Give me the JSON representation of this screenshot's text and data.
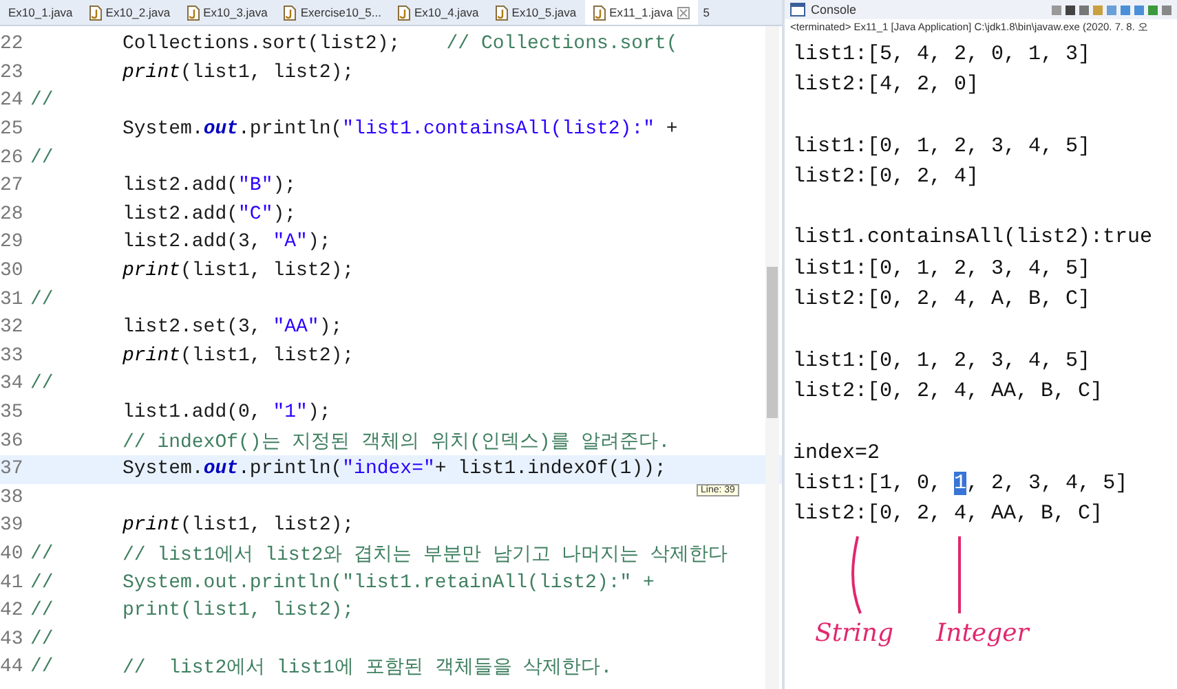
{
  "editor": {
    "tabs": [
      {
        "label": "Ex10_1.java",
        "selected": false,
        "icon": false
      },
      {
        "label": "Ex10_2.java",
        "selected": false,
        "icon": true
      },
      {
        "label": "Ex10_3.java",
        "selected": false,
        "icon": true
      },
      {
        "label": "Exercise10_5...",
        "selected": false,
        "icon": true
      },
      {
        "label": "Ex10_4.java",
        "selected": false,
        "icon": true
      },
      {
        "label": "Ex10_5.java",
        "selected": false,
        "icon": true
      },
      {
        "label": "Ex11_1.java",
        "selected": true,
        "icon": true
      }
    ],
    "overflow": "5",
    "lines": [
      {
        "number": "22",
        "current": false,
        "tokens": [
          {
            "kind": "plain",
            "text": "Collections.sort(list2);    "
          },
          {
            "kind": "comment",
            "text": "// Collections.sort("
          }
        ]
      },
      {
        "number": "23",
        "current": false,
        "tokens": [
          {
            "kind": "method",
            "text": "print"
          },
          {
            "kind": "plain",
            "text": "(list1, list2);"
          }
        ]
      },
      {
        "number": "24",
        "current": false,
        "marker": "//"
      },
      {
        "number": "25",
        "current": false,
        "tokens": [
          {
            "kind": "plain",
            "text": "System."
          },
          {
            "kind": "field",
            "text": "out"
          },
          {
            "kind": "plain",
            "text": ".println("
          },
          {
            "kind": "string",
            "text": "\"list1.containsAll(list2):\""
          },
          {
            "kind": "plain",
            "text": " +"
          }
        ]
      },
      {
        "number": "26",
        "current": false,
        "marker": "//"
      },
      {
        "number": "27",
        "current": false,
        "tokens": [
          {
            "kind": "plain",
            "text": "list2.add("
          },
          {
            "kind": "string",
            "text": "\"B\""
          },
          {
            "kind": "plain",
            "text": ");"
          }
        ]
      },
      {
        "number": "28",
        "current": false,
        "tokens": [
          {
            "kind": "plain",
            "text": "list2.add("
          },
          {
            "kind": "string",
            "text": "\"C\""
          },
          {
            "kind": "plain",
            "text": ");"
          }
        ]
      },
      {
        "number": "29",
        "current": false,
        "tokens": [
          {
            "kind": "plain",
            "text": "list2.add(3, "
          },
          {
            "kind": "string",
            "text": "\"A\""
          },
          {
            "kind": "plain",
            "text": ");"
          }
        ]
      },
      {
        "number": "30",
        "current": false,
        "tokens": [
          {
            "kind": "method",
            "text": "print"
          },
          {
            "kind": "plain",
            "text": "(list1, list2);"
          }
        ]
      },
      {
        "number": "31",
        "current": false,
        "marker": "//"
      },
      {
        "number": "32",
        "current": false,
        "tokens": [
          {
            "kind": "plain",
            "text": "list2.set(3, "
          },
          {
            "kind": "string",
            "text": "\"AA\""
          },
          {
            "kind": "plain",
            "text": ");"
          }
        ]
      },
      {
        "number": "33",
        "current": false,
        "tokens": [
          {
            "kind": "method",
            "text": "print"
          },
          {
            "kind": "plain",
            "text": "(list1, list2);"
          }
        ]
      },
      {
        "number": "34",
        "current": false,
        "marker": "//"
      },
      {
        "number": "35",
        "current": false,
        "tokens": [
          {
            "kind": "plain",
            "text": "list1.add(0, "
          },
          {
            "kind": "string",
            "text": "\"1\""
          },
          {
            "kind": "plain",
            "text": ");"
          }
        ]
      },
      {
        "number": "36",
        "current": false,
        "tokens": [
          {
            "kind": "comment",
            "text": "// indexOf()는 지정된 객체의 위치(인덱스)를 알려준다."
          }
        ]
      },
      {
        "number": "37",
        "current": true,
        "tokens": [
          {
            "kind": "plain",
            "text": "System."
          },
          {
            "kind": "field",
            "text": "out"
          },
          {
            "kind": "plain",
            "text": ".println("
          },
          {
            "kind": "string",
            "text": "\"index=\""
          },
          {
            "kind": "plain",
            "text": "+ list1.indexOf(1));"
          }
        ]
      },
      {
        "number": "38",
        "current": false
      },
      {
        "number": "39",
        "current": false,
        "tokens": [
          {
            "kind": "method",
            "text": "print"
          },
          {
            "kind": "plain",
            "text": "(list1, list2);"
          }
        ]
      },
      {
        "number": "40",
        "current": false,
        "marker": "//",
        "tokens": [
          {
            "kind": "comment",
            "text": "// list1에서 list2와 겹치는 부분만 남기고 나머지는 삭제한다"
          }
        ]
      },
      {
        "number": "41",
        "current": false,
        "marker": "//",
        "tokens": [
          {
            "kind": "comment",
            "text": "System.out.println(\"list1.retainAll(list2):\" +"
          }
        ]
      },
      {
        "number": "42",
        "current": false,
        "marker": "//",
        "tokens": [
          {
            "kind": "comment",
            "text": "print(list1, list2);"
          }
        ]
      },
      {
        "number": "43",
        "current": false,
        "marker": "//"
      },
      {
        "number": "44",
        "current": false,
        "marker": "//",
        "tokens": [
          {
            "kind": "comment",
            "text": "//  list2에서 list1에 포함된 객체들을 삭제한다."
          }
        ]
      }
    ],
    "tooltip": "Line: 39"
  },
  "console": {
    "title": "Console",
    "status": "<terminated> Ex11_1 [Java Application] C:\\jdk1.8\\bin\\javaw.exe (2020. 7. 8. 오",
    "output": [
      {
        "space_before": false,
        "segments": [
          {
            "text": "list1:[5, 4, 2, 0, 1, 3]",
            "selected": false
          }
        ]
      },
      {
        "space_before": false,
        "segments": [
          {
            "text": "list2:[4, 2, 0]",
            "selected": false
          }
        ]
      },
      {
        "space_before": true,
        "segments": [
          {
            "text": "list1:[0, 1, 2, 3, 4, 5]",
            "selected": false
          }
        ]
      },
      {
        "space_before": false,
        "segments": [
          {
            "text": "list2:[0, 2, 4]",
            "selected": false
          }
        ]
      },
      {
        "space_before": true,
        "segments": [
          {
            "text": "list1.containsAll(list2):true",
            "selected": false
          }
        ]
      },
      {
        "space_before": false,
        "segments": [
          {
            "text": "list1:[0, 1, 2, 3, 4, 5]",
            "selected": false
          }
        ]
      },
      {
        "space_before": false,
        "segments": [
          {
            "text": "list2:[0, 2, 4, A, B, C]",
            "selected": false
          }
        ]
      },
      {
        "space_before": true,
        "segments": [
          {
            "text": "list1:[0, 1, 2, 3, 4, 5]",
            "selected": false
          }
        ]
      },
      {
        "space_before": false,
        "segments": [
          {
            "text": "list2:[0, 2, 4, AA, B, C]",
            "selected": false
          }
        ]
      },
      {
        "space_before": true,
        "segments": [
          {
            "text": "index=2",
            "selected": false
          }
        ]
      },
      {
        "space_before": false,
        "segments": [
          {
            "text": "list1:[1, 0, ",
            "selected": false
          },
          {
            "text": "1",
            "selected": true
          },
          {
            "text": ", 2, 3, 4, 5]",
            "selected": false
          }
        ]
      },
      {
        "space_before": false,
        "segments": [
          {
            "text": "list2:[0, 2, 4, AA, B, C]",
            "selected": false
          }
        ]
      }
    ],
    "annotations": [
      "String",
      "Integer"
    ]
  }
}
